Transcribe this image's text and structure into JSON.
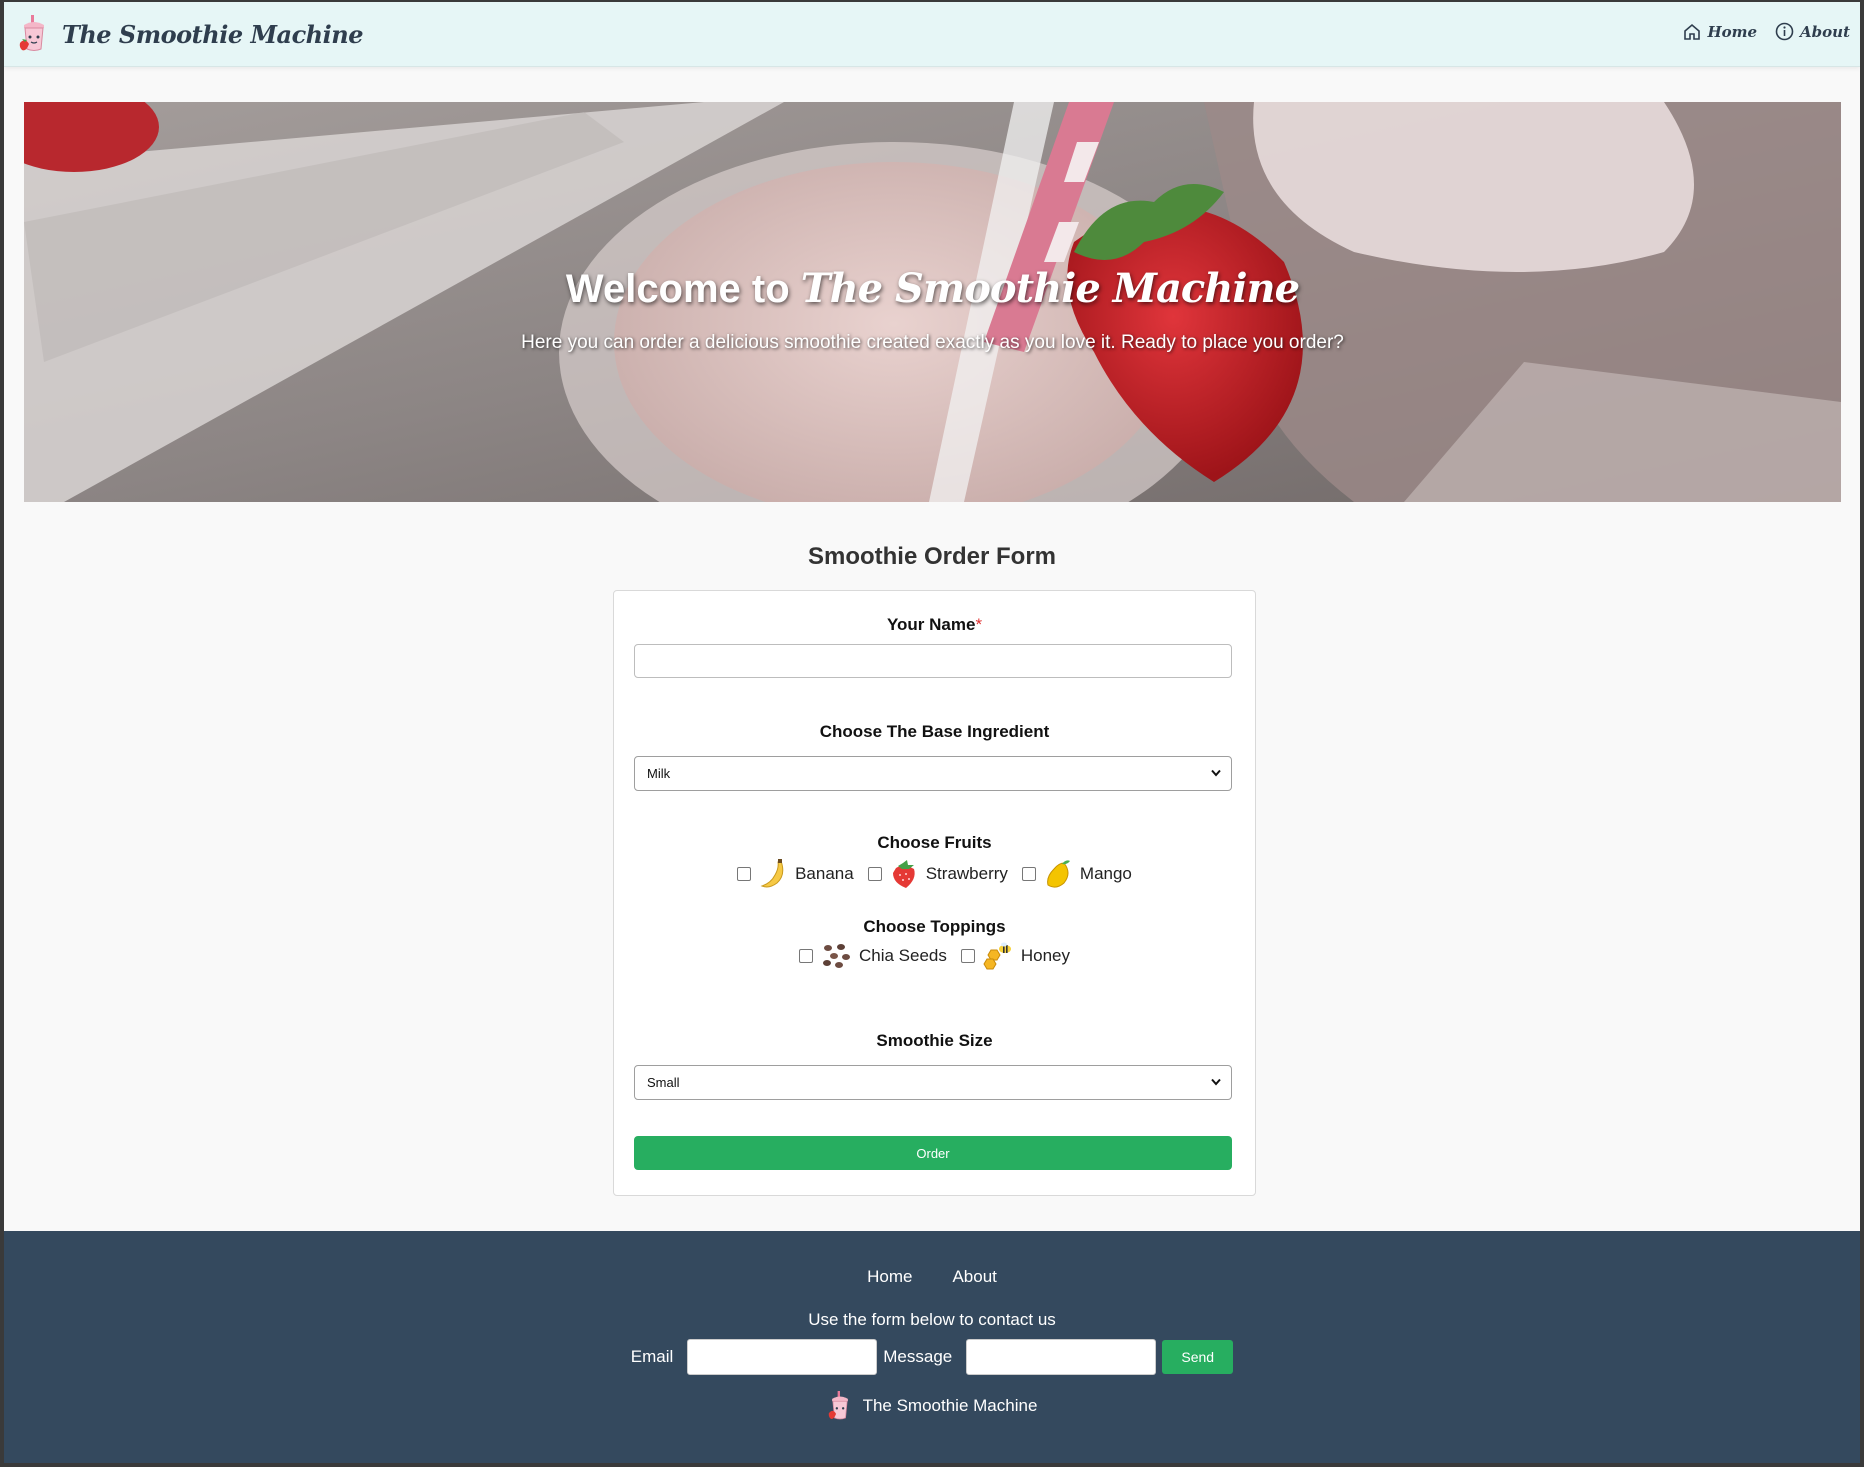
{
  "header": {
    "brand": "The Smoothie Machine",
    "nav": [
      {
        "label": "Home",
        "icon": "home-icon"
      },
      {
        "label": "About",
        "icon": "info-icon"
      }
    ]
  },
  "hero": {
    "title_prefix": "Welcome to",
    "title_brand": "The Smoothie Machine",
    "subtitle": "Here you can order a delicious smoothie created exactly as you love it. Ready to place you order?"
  },
  "form": {
    "heading": "Smoothie Order Form",
    "name_label": "Your Name",
    "required_mark": "*",
    "name_value": "",
    "base_label": "Choose The Base Ingredient",
    "base_selected": "Milk",
    "fruits_label": "Choose Fruits",
    "fruits": [
      {
        "label": "Banana",
        "icon": "banana-icon",
        "checked": false
      },
      {
        "label": "Strawberry",
        "icon": "strawberry-icon",
        "checked": false
      },
      {
        "label": "Mango",
        "icon": "mango-icon",
        "checked": false
      }
    ],
    "toppings_label": "Choose Toppings",
    "toppings": [
      {
        "label": "Chia Seeds",
        "icon": "chia-seeds-icon",
        "checked": false
      },
      {
        "label": "Honey",
        "icon": "honey-icon",
        "checked": false
      }
    ],
    "size_label": "Smoothie Size",
    "size_selected": "Small",
    "order_button": "Order"
  },
  "footer": {
    "nav": [
      "Home",
      "About"
    ],
    "contact_text": "Use the form below to contact us",
    "email_label": "Email",
    "message_label": "Message",
    "send_button": "Send",
    "brand": "The Smoothie Machine"
  },
  "colors": {
    "header_bg": "#e6f6f6",
    "footer_bg": "#34495e",
    "accent_green": "#27ae60",
    "required_red": "#e03030"
  }
}
